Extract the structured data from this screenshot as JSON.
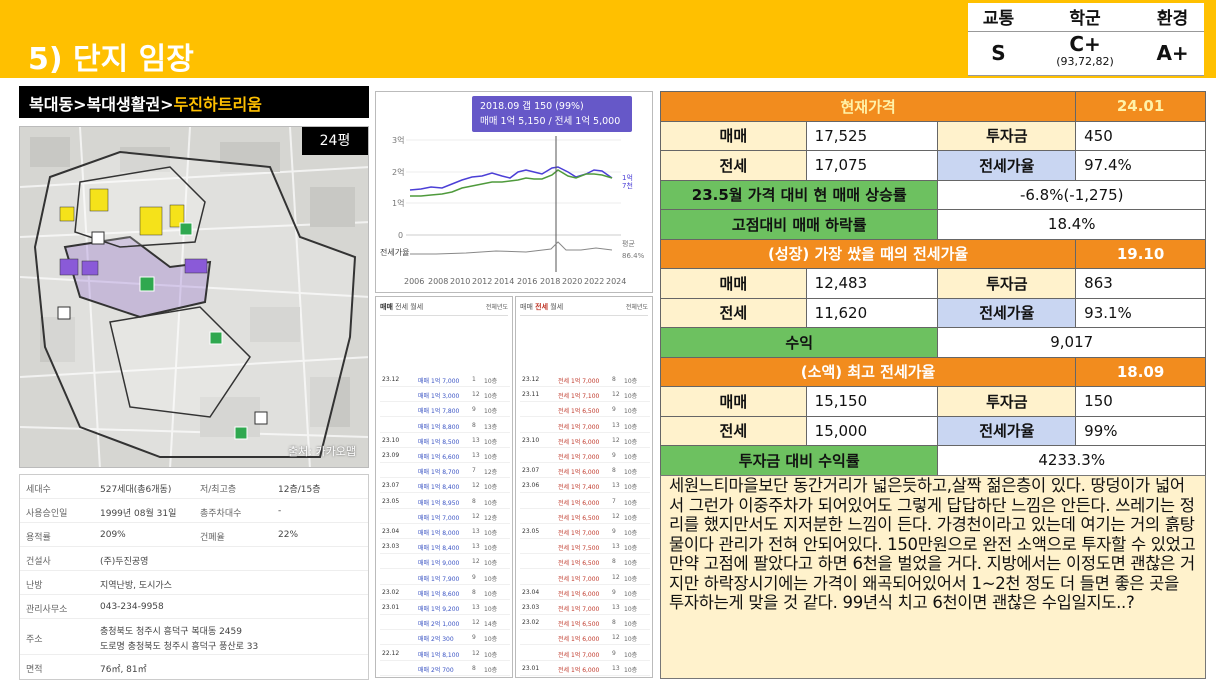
{
  "header": {
    "title": "5) 단지 임장"
  },
  "grades": {
    "headers": [
      "교통",
      "학군",
      "환경"
    ],
    "values": [
      "S",
      "C+",
      "A+"
    ],
    "school_sub": "(93,72,82)"
  },
  "breadcrumb": {
    "prefix": "복대동>복대생활권>",
    "highlight": "두진하트리움"
  },
  "map": {
    "badge": "24평",
    "credit": "출처: 카카오맵"
  },
  "info": [
    {
      "label": "세대수",
      "value": "527세대(총6개동)",
      "label2": "저/최고층",
      "value2": "12층/15층"
    },
    {
      "label": "사용승인일",
      "value": "1999년 08월 31일",
      "label2": "총주차대수",
      "value2": "-"
    },
    {
      "label": "용적률",
      "value": "209%",
      "label2": "건폐율",
      "value2": "22%"
    },
    {
      "label": "건설사",
      "value": "(주)두진공영"
    },
    {
      "label": "난방",
      "value": "지역난방, 도시가스"
    },
    {
      "label": "관리사무소",
      "value": "043-234-9958"
    },
    {
      "label": "주소",
      "value": "충청북도 청주시 흥덕구 복대동 2459",
      "value_b": "도로명  충청북도 청주시 흥덕구 풍산로 33"
    },
    {
      "label": "면적",
      "value": "76㎡, 81㎡"
    }
  ],
  "price_chart": {
    "tooltip_line1": "2018.09  갭 150 (99%)",
    "tooltip_line2": "매매 1억 5,150 / 전세 1억 5,000",
    "y_ticks": [
      "3억",
      "2억",
      "1억",
      "0"
    ],
    "x_ticks": [
      "2006",
      "2008",
      "2010",
      "2012",
      "2014",
      "2016",
      "2018",
      "2020",
      "2022",
      "2024"
    ],
    "ratio_label": "전세가율",
    "end_label_right": "86.4%",
    "end_label_top": "평균",
    "end_value_1": "1억",
    "end_value_2": "7천"
  },
  "list_left": {
    "tabs": [
      "매매",
      "전세",
      "월세"
    ],
    "filter": "전체년도",
    "rows": [
      [
        "23.12",
        "매매 1억 7,000",
        "1",
        "10층"
      ],
      [
        "",
        "매매 1억 3,000",
        "12",
        "10층"
      ],
      [
        "",
        "매매 1억 7,800",
        "9",
        "10층"
      ],
      [
        "",
        "매매 1억 8,800",
        "8",
        "13층"
      ],
      [
        "23.10",
        "매매 1억 8,500",
        "13",
        "10층"
      ],
      [
        "23.09",
        "매매 1억 6,600",
        "13",
        "10층"
      ],
      [
        "",
        "매매 1억 8,700",
        "7",
        "12층"
      ],
      [
        "23.07",
        "매매 1억 8,400",
        "12",
        "10층"
      ],
      [
        "23.05",
        "매매 1억 8,950",
        "8",
        "10층"
      ],
      [
        "",
        "매매 1억 7,000",
        "12",
        "12층"
      ],
      [
        "23.04",
        "매매 1억 8,000",
        "13",
        "10층"
      ],
      [
        "23.03",
        "매매 1억 8,400",
        "13",
        "10층"
      ],
      [
        "",
        "매매 1억 9,000",
        "12",
        "10층"
      ],
      [
        "",
        "매매 1억 7,900",
        "9",
        "10층"
      ],
      [
        "23.02",
        "매매 1억 8,600",
        "8",
        "10층"
      ],
      [
        "23.01",
        "매매 1억 9,200",
        "13",
        "10층"
      ],
      [
        "",
        "매매 2억 1,000",
        "12",
        "14층"
      ],
      [
        "",
        "매매 2억 300",
        "9",
        "10층"
      ],
      [
        "22.12",
        "매매 1억 8,100",
        "12",
        "10층"
      ],
      [
        "",
        "매매 2억 700",
        "8",
        "10층"
      ]
    ]
  },
  "list_right": {
    "tabs": [
      "매매",
      "전세",
      "월세"
    ],
    "filter": "전체년도",
    "rows": [
      [
        "23.12",
        "전세 1억 7,000",
        "8",
        "10층"
      ],
      [
        "23.11",
        "전세 1억 7,100",
        "12",
        "10층"
      ],
      [
        "",
        "전세 1억 6,500",
        "9",
        "10층"
      ],
      [
        "",
        "전세 1억 7,000",
        "13",
        "10층"
      ],
      [
        "23.10",
        "전세 1억 6,000",
        "12",
        "10층"
      ],
      [
        "",
        "전세 1억 7,000",
        "9",
        "10층"
      ],
      [
        "23.07",
        "전세 1억 6,000",
        "8",
        "10층"
      ],
      [
        "23.06",
        "전세 1억 7,400",
        "13",
        "10층"
      ],
      [
        "",
        "전세 1억 6,000",
        "7",
        "10층"
      ],
      [
        "",
        "전세 1억 6,500",
        "12",
        "10층"
      ],
      [
        "23.05",
        "전세 1억 7,000",
        "9",
        "10층"
      ],
      [
        "",
        "전세 1억 7,500",
        "13",
        "10층"
      ],
      [
        "",
        "전세 1억 6,500",
        "8",
        "10층"
      ],
      [
        "",
        "전세 1억 7,000",
        "12",
        "10층"
      ],
      [
        "23.04",
        "전세 1억 6,000",
        "9",
        "10층"
      ],
      [
        "23.03",
        "전세 1억 7,000",
        "13",
        "10층"
      ],
      [
        "23.02",
        "전세 1억 6,500",
        "8",
        "10층"
      ],
      [
        "",
        "전세 1억 6,000",
        "12",
        "10층"
      ],
      [
        "",
        "전세 1억 7,000",
        "9",
        "10층"
      ],
      [
        "23.01",
        "전세 1억 6,000",
        "13",
        "10층"
      ]
    ]
  },
  "summary": {
    "current_label": "현재가격",
    "current_date": "24.01",
    "sale_label": "매매",
    "jeonse_label": "전세",
    "invest_label": "투자금",
    "ratio_label": "전세가율",
    "current_sale": "17,525",
    "current_invest": "450",
    "current_jeonse": "17,075",
    "current_ratio": "97.4%",
    "rise_label": "23.5월 가격 대비 현 매매 상승률",
    "rise_value": "-6.8%(-1,275)",
    "drop_label": "고점대비 매매 하락률",
    "drop_value": "18.4%",
    "growth_label": "(성장) 가장 쌌을 때의 전세가율",
    "growth_date": "19.10",
    "growth_sale": "12,483",
    "growth_invest": "863",
    "growth_jeonse": "11,620",
    "growth_ratio": "93.1%",
    "profit_label": "수익",
    "profit_value": "9,017",
    "small_label": "(소액) 최고 전세가율",
    "small_date": "18.09",
    "small_sale": "15,150",
    "small_invest": "150",
    "small_jeonse": "15,000",
    "small_ratio": "99%",
    "return_label": "투자금 대비 수익률",
    "return_value": "4233.3%"
  },
  "note": "세원느티마을보단 동간거리가 넓은듯하고,살짝 젊은층이 있다. 땅덩이가 넓어서 그런가 이중주차가 되어있어도 그렇게 답답하단 느낌은 안든다. 쓰레기는 정리를 했지만서도 지저분한 느낌이 든다. 가경천이라고 있는데 여기는 거의 흙탕물이다 관리가 전혀 안되어있다. 150만원으로 완전 소액으로 투자할 수 있었고 만약 고점에 팔았다고 하면 6천을 벌었을 거다. 지방에서는 이정도면 괜찮은 거지만 하락장시기에는 가격이 왜곡되어있어서 1~2천 정도 더 들면 좋은 곳을 투자하는게 맞을 것 같다. 99년식 치고 6천이면 괜찮은 수입일지도..?",
  "colors": {
    "brand": "#FFC000",
    "accent_orange": "#F28C1E",
    "green": "#6DC160",
    "cream": "#FFF2CC",
    "blue": "#C9D6F2",
    "chart_purple": "#4b3fd6",
    "chart_green": "#4f9a3c"
  }
}
